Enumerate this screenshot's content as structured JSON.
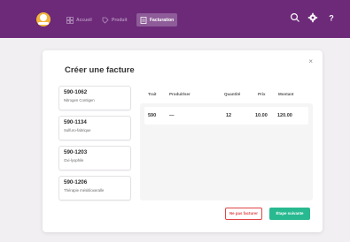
{
  "nav": {
    "items": [
      {
        "label": "Accueil",
        "icon": "grid-icon"
      },
      {
        "label": "Produit",
        "icon": "tag-icon"
      },
      {
        "label": "Facturation",
        "icon": "invoice-icon"
      }
    ]
  },
  "dialog": {
    "title": "Créer une facture",
    "close_symbol": "×",
    "invoices": [
      {
        "id": "590-1062",
        "name": "Nitrogen Contigen"
      },
      {
        "id": "590-1134",
        "name": "Sulfuro-fabrique"
      },
      {
        "id": "590-1203",
        "name": "Oxi-lyophile"
      },
      {
        "id": "590-1206",
        "name": "Thérapie mésitiloxeralle"
      }
    ],
    "table": {
      "headers": [
        "Trait",
        "Produit/ser",
        "Quantité",
        "Prix",
        "Montant"
      ],
      "rows": [
        {
          "code": "590",
          "product": "—",
          "qty": "12",
          "price": "10.00",
          "amount": "120.00"
        }
      ]
    },
    "buttons": {
      "cancel": "Ne pas facturer",
      "next": "Étape suivante"
    }
  },
  "colors": {
    "topbar": "#6d2a79",
    "accent_green": "#28b990",
    "danger_red": "#e04545"
  }
}
